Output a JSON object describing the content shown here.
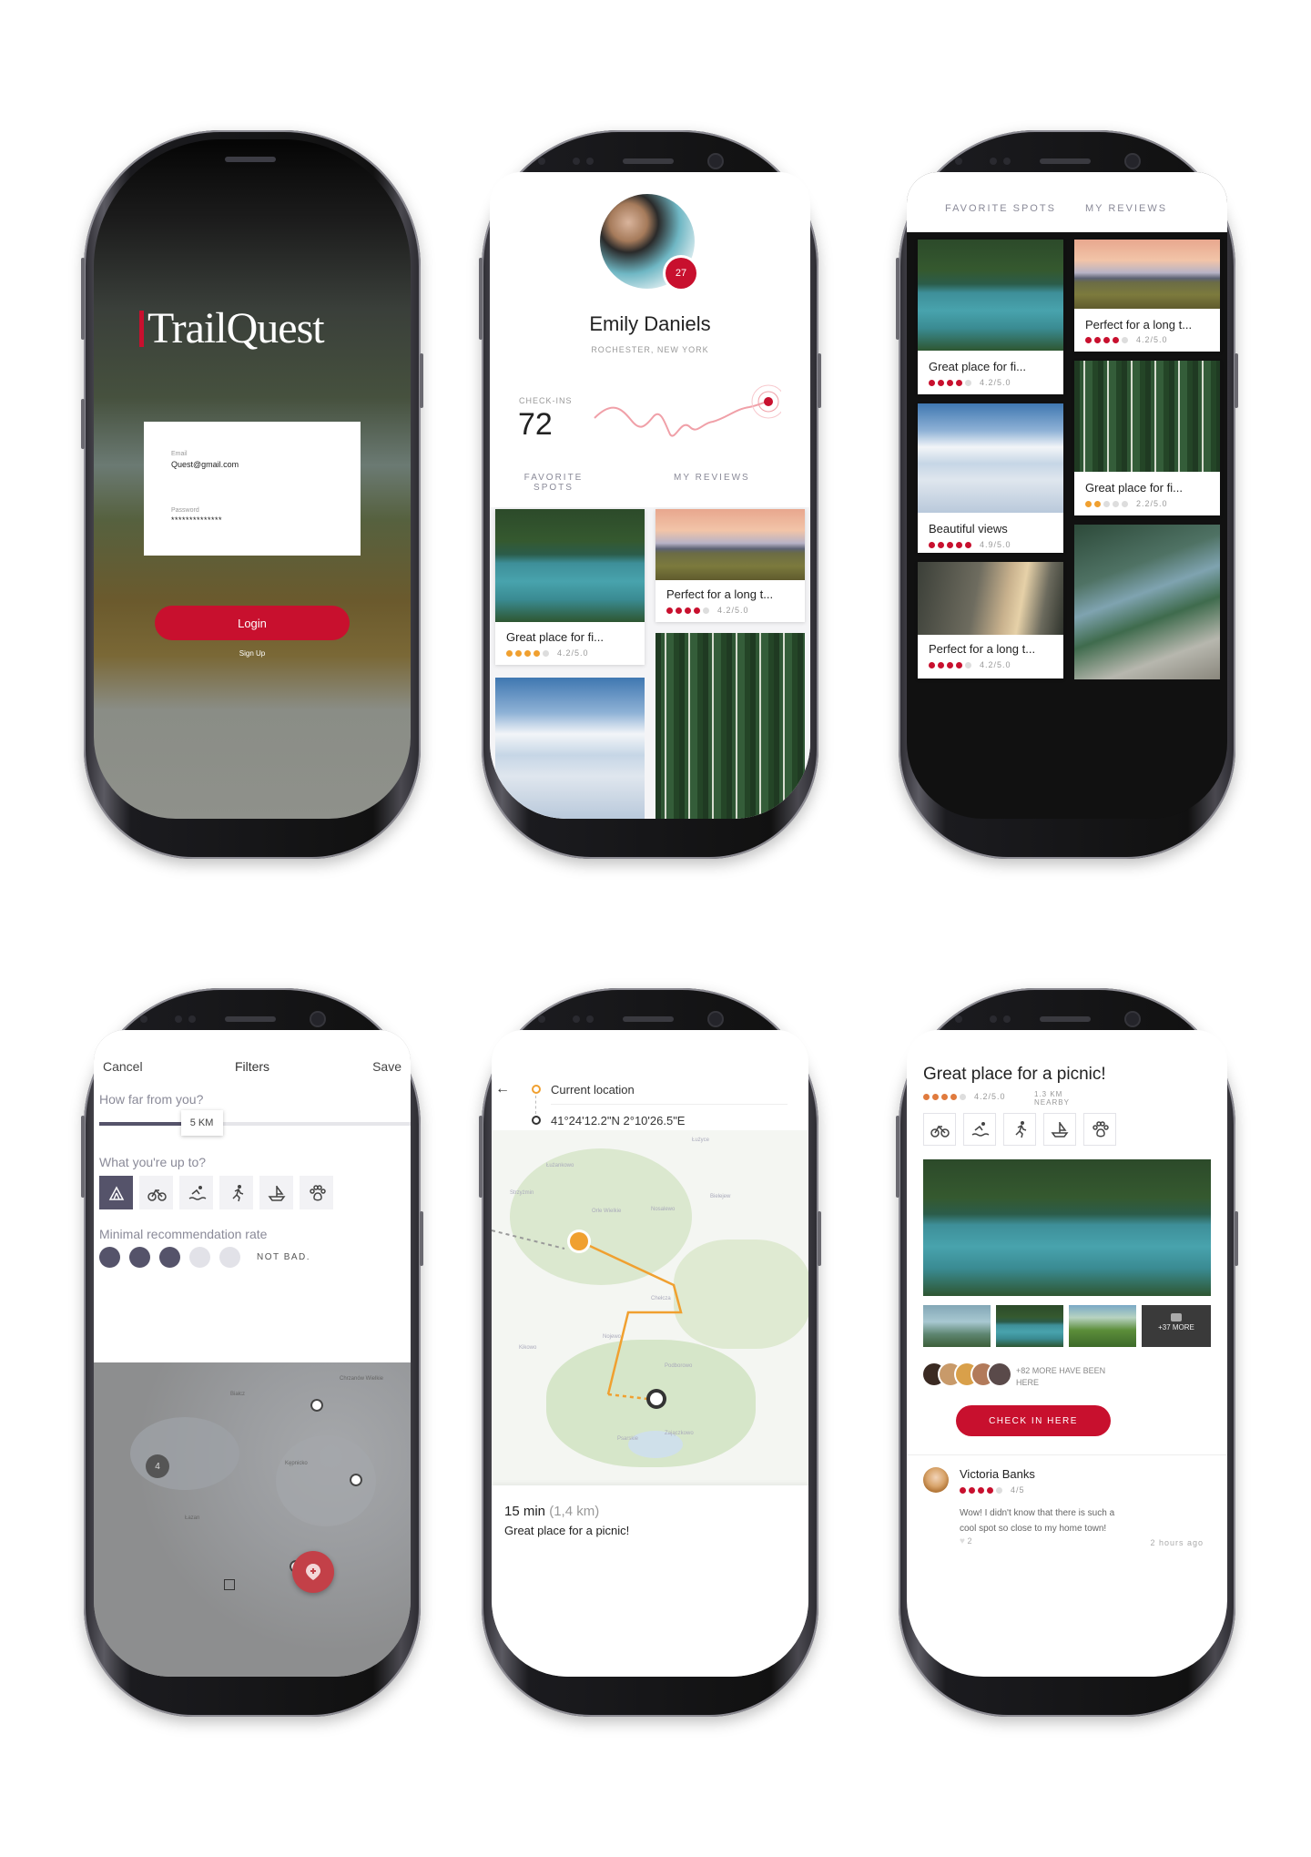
{
  "login": {
    "logo": "TrailQuest",
    "email_label": "Email",
    "email_value": "Quest@gmail.com",
    "password_label": "Password",
    "password_value": "**************",
    "login_button": "Login",
    "signup_link": "Sign Up"
  },
  "profile": {
    "name": "Emily Daniels",
    "location": "ROCHESTER, NEW YORK",
    "badge": "27",
    "checkins_label": "CHECK-INS",
    "checkins_value": "72",
    "tab_favorites": "FAVORITE SPOTS",
    "tab_reviews": "MY REVIEWS",
    "cards": [
      {
        "title": "Great place for fi...",
        "rating": "4.2/5.0"
      },
      {
        "title": "Perfect for a long t...",
        "rating": "4.2/5.0"
      }
    ]
  },
  "gallery": {
    "tab_favorites": "FAVORITE SPOTS",
    "tab_reviews": "MY REVIEWS",
    "cards": [
      {
        "title": "Great place for fi...",
        "rating": "4.2/5.0"
      },
      {
        "title": "Perfect for a long t...",
        "rating": "4.2/5.0"
      },
      {
        "title": "Beautiful views",
        "rating": "4.9/5.0"
      },
      {
        "title": "Great place for fi...",
        "rating": "2.2/5.0"
      },
      {
        "title": "Perfect for a long t...",
        "rating": "4.2/5.0"
      }
    ]
  },
  "filters": {
    "cancel": "Cancel",
    "title": "Filters",
    "save": "Save",
    "distance_question": "How far from you?",
    "distance_value": "5 KM",
    "distance_fraction": 0.3,
    "activity_question": "What you're up to?",
    "rate_question": "Minimal recommendation rate",
    "rate_text": "NOT BAD.",
    "rate_level": 3,
    "map_cluster": "4",
    "activities": [
      "camping-icon",
      "bike-icon",
      "swim-icon",
      "run-icon",
      "boat-icon",
      "paw-icon"
    ],
    "map_labels": [
      "Chrzanów Wielkie",
      "Białcz",
      "Kępnicko",
      "Łazan"
    ]
  },
  "route": {
    "current_location": "Current location",
    "coordinates": "41°24'12.2\"N 2°10'26.5\"E",
    "duration": "15 min",
    "distance": "(1,4 km)",
    "destination": "Great place for a picnic!",
    "map_labels": [
      "Łużyce",
      "Łużankowo",
      "Strzyżmin",
      "Orle Wielkie",
      "Nosalewo",
      "Bielejew",
      "Chełcza",
      "Nojewo",
      "Kikowo",
      "Podborowo",
      "Psarskie",
      "Zajączkowo"
    ]
  },
  "spot": {
    "title": "Great place for a picnic!",
    "rating": "4.2/5.0",
    "distance": "1.3 KM NEARBY",
    "more_photos": "+37 MORE",
    "visitors_text": "+82 MORE HAVE BEEN HERE",
    "checkin_button": "CHECK IN HERE",
    "review": {
      "name": "Victoria Banks",
      "rating": "4/5",
      "text": "Wow! I didn't know that there is such a cool spot so close to my home town!",
      "likes": "2",
      "time": "2 hours ago"
    }
  },
  "colors": {
    "accent": "#c8102e",
    "orange": "#f0a030",
    "dark": "#55536a"
  }
}
